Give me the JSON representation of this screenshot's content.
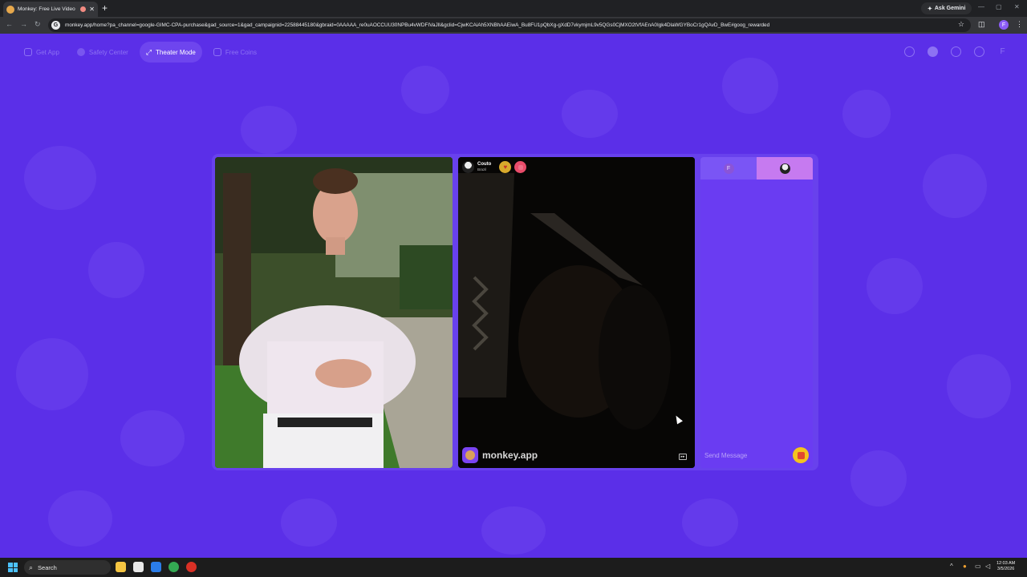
{
  "browser": {
    "tab_title": "Monkey: Free Live Video Ch",
    "url": "monkey.app/home?pa_channel=google-GIMC-CPA-purchase&gad_source=1&gad_campaignid=22588445180&gbraid=0AAAAA_re0uAOCCUU30NPBu4vWDFIVaJlI&gclid=CjwKCAiAh5XNBhAAEiwA_Bu8FU1pQbXg-gXdD7vkymjmL9v5QGs0CjMXO2tVfAEnA0Igk4DlaWGYBoCr1gQAvD_BwE#goog_rewarded",
    "gemini_label": "Ask Gemini",
    "profile_initial": "F"
  },
  "nav": {
    "items": [
      {
        "label": "Get App",
        "active": false
      },
      {
        "label": "Safety Center",
        "active": false
      },
      {
        "label": "Theater Mode",
        "active": true
      },
      {
        "label": "Free Coins",
        "active": false
      }
    ],
    "profile_initial": "F"
  },
  "remote_user": {
    "name": "Couto",
    "country": "Brazil"
  },
  "watermark": "monkey.app",
  "chat": {
    "my_initial": "F",
    "placeholder": "Send Message"
  },
  "taskbar": {
    "search_label": "Search",
    "time": "12:03 AM",
    "date": "3/5/2026"
  },
  "colors": {
    "page_bg": "#5b2fe8",
    "active_nav": "#6e45ee",
    "chat_panel": "#6a3cf2",
    "gift_button": "#f5c31d"
  }
}
